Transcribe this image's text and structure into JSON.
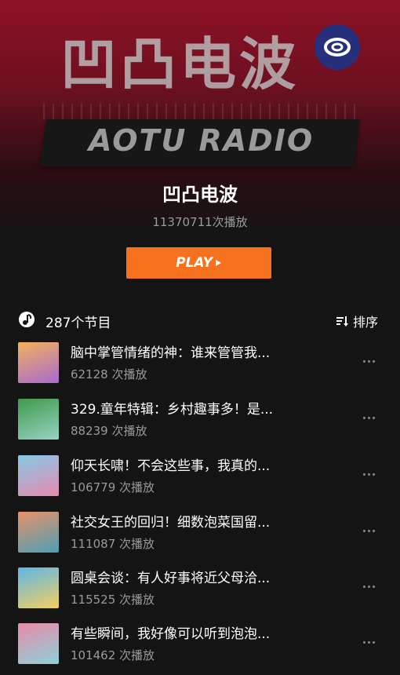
{
  "header": {
    "logo_cn": "凹凸电波",
    "logo_en": "AOTU RADIO",
    "title": "凹凸电波",
    "plays": "11370711次播放",
    "play_label": "PLAY",
    "badge_icon": "ring-logo-icon"
  },
  "list": {
    "count_label": "287个节目",
    "sort_label": "排序",
    "items": [
      {
        "title": "脑中掌管情绪的神：谁来管管我...",
        "plays": "62128 次播放",
        "thumb_colors": [
          "#f3b15a",
          "#a86ad2"
        ]
      },
      {
        "title": "329.童年特辑：乡村趣事多！是...",
        "plays": "88239 次播放",
        "thumb_colors": [
          "#3f9a4b",
          "#98d2c4"
        ]
      },
      {
        "title": "仰天长啸！不会这些事，我真的...",
        "plays": "106779 次播放",
        "thumb_colors": [
          "#86c9e6",
          "#e78aaf"
        ]
      },
      {
        "title": "社交女王的回归！细数泡菜国留...",
        "plays": "111087 次播放",
        "thumb_colors": [
          "#e8916a",
          "#4e9fb4"
        ]
      },
      {
        "title": "圆桌会谈：有人好事将近父母洽...",
        "plays": "115525 次播放",
        "thumb_colors": [
          "#5fb6e8",
          "#f3d060"
        ]
      },
      {
        "title": "有些瞬间，我好像可以听到泡泡...",
        "plays": "101462 次播放",
        "thumb_colors": [
          "#e88ba8",
          "#8fd0d8"
        ]
      }
    ]
  },
  "colors": {
    "accent": "#f6721f",
    "hero_top": "#8e1226",
    "background": "#141414"
  }
}
